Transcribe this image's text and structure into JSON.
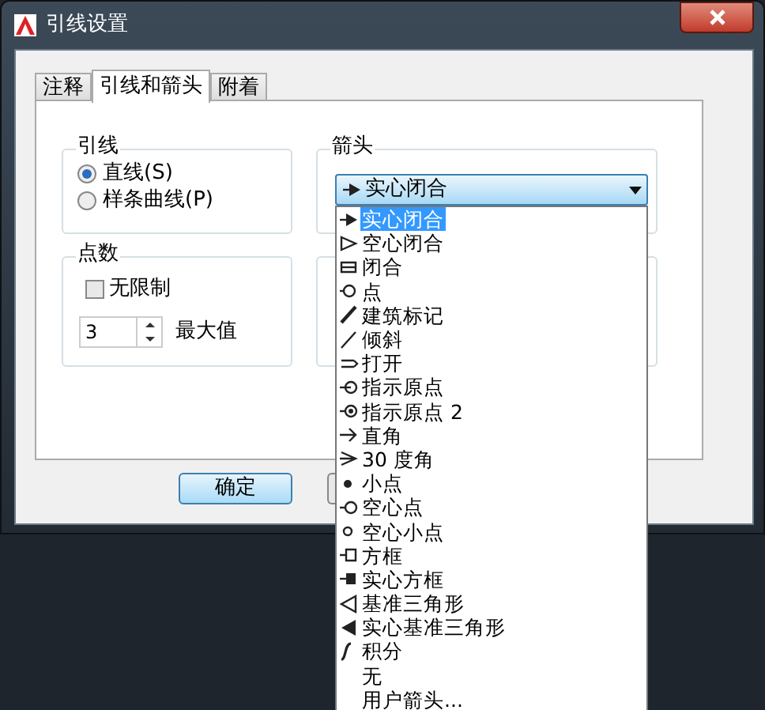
{
  "window": {
    "title": "引线设置"
  },
  "tabs": [
    {
      "label": "注释",
      "selected": false
    },
    {
      "label": "引线和箭头",
      "selected": true
    },
    {
      "label": "附着",
      "selected": false
    }
  ],
  "leader_group": {
    "title": "引线",
    "options": [
      {
        "label": "直线(S)",
        "selected": true
      },
      {
        "label": "样条曲线(P)",
        "selected": false
      }
    ]
  },
  "arrow_group": {
    "title": "箭头",
    "dropdown": {
      "value": "实心闭合",
      "kind": "filled-arrow",
      "expanded": true,
      "options": [
        {
          "label": "实心闭合",
          "kind": "filled-arrow",
          "selected": true
        },
        {
          "label": "空心闭合",
          "kind": "hollow-arrow",
          "selected": false
        },
        {
          "label": "闭合",
          "kind": "closed",
          "selected": false
        },
        {
          "label": "点",
          "kind": "ring",
          "selected": false
        },
        {
          "label": "建筑标记",
          "kind": "thick-slash",
          "selected": false
        },
        {
          "label": "倾斜",
          "kind": "slash",
          "selected": false
        },
        {
          "label": "打开",
          "kind": "open",
          "selected": false
        },
        {
          "label": "指示原点",
          "kind": "origin",
          "selected": false
        },
        {
          "label": "指示原点 2",
          "kind": "origin2",
          "selected": false
        },
        {
          "label": "直角",
          "kind": "right-angle",
          "selected": false
        },
        {
          "label": "30 度角",
          "kind": "angle30",
          "selected": false
        },
        {
          "label": "小点",
          "kind": "small-dot",
          "selected": false
        },
        {
          "label": "空心点",
          "kind": "hollow-dot",
          "selected": false
        },
        {
          "label": "空心小点",
          "kind": "small-hollow-dot",
          "selected": false
        },
        {
          "label": "方框",
          "kind": "box",
          "selected": false
        },
        {
          "label": "实心方框",
          "kind": "filled-box",
          "selected": false
        },
        {
          "label": "基准三角形",
          "kind": "datum",
          "selected": false
        },
        {
          "label": "实心基准三角形",
          "kind": "filled-datum",
          "selected": false
        },
        {
          "label": "积分",
          "kind": "integral",
          "selected": false
        },
        {
          "label": "无",
          "kind": "none",
          "selected": false
        },
        {
          "label": "用户箭头...",
          "kind": "none",
          "selected": false
        }
      ]
    }
  },
  "points_group": {
    "title": "点数",
    "unlimited": {
      "label": "无限制",
      "checked": false
    },
    "max": {
      "value": "3",
      "label": "最大值"
    }
  },
  "buttons": [
    {
      "label": "确定"
    }
  ]
}
